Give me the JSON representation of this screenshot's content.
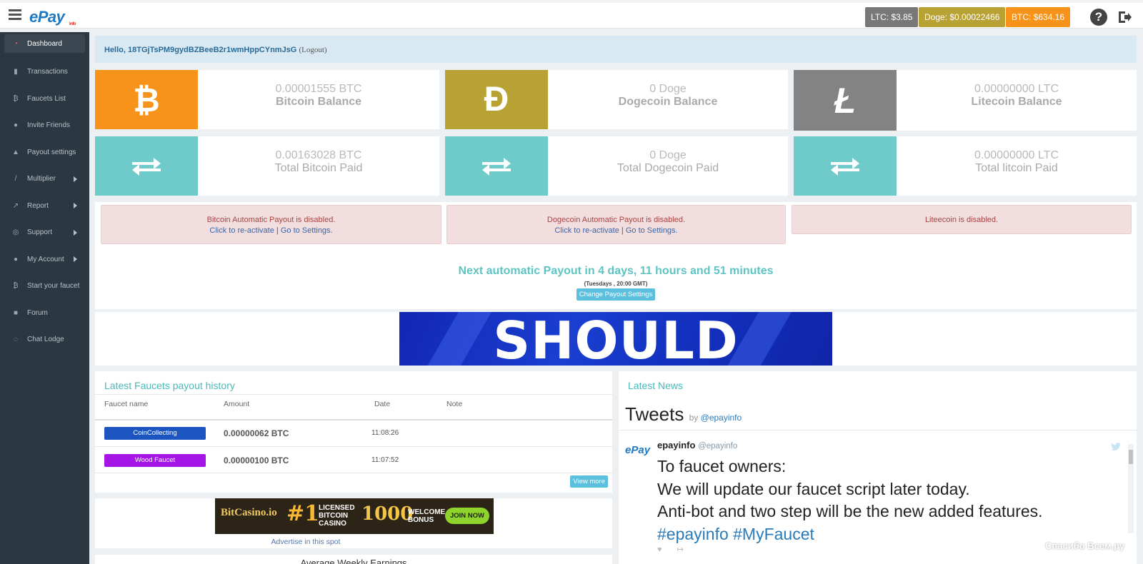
{
  "app": {
    "logo": "ePay",
    "logo_tag": "info"
  },
  "prices": [
    {
      "label": "LTC: $3.85",
      "color": "#787878"
    },
    {
      "label": "Doge: $0.00022466",
      "color": "#b8a234"
    },
    {
      "label": "BTC: $634.16",
      "color": "#f7931a"
    }
  ],
  "sidebar": {
    "items": [
      {
        "label": "Dashboard",
        "icon": "dashboard-icon"
      },
      {
        "label": "Transactions",
        "icon": "bar-chart-icon"
      },
      {
        "label": "Faucets List",
        "icon": "bitcoin-icon"
      },
      {
        "label": "Invite Friends",
        "icon": "users-icon"
      },
      {
        "label": "Payout settings",
        "icon": "bank-icon"
      },
      {
        "label": "Multiplier",
        "icon": "magic-wand-icon"
      },
      {
        "label": "Report",
        "icon": "line-chart-icon"
      },
      {
        "label": "Support",
        "icon": "lifebuoy-icon"
      },
      {
        "label": "My Account",
        "icon": "user-icon"
      },
      {
        "label": "Start your faucet",
        "icon": "bitcoin-icon"
      },
      {
        "label": "Forum",
        "icon": "comments-icon"
      },
      {
        "label": "Chat Lodge",
        "icon": "chat-icon"
      }
    ]
  },
  "hello": {
    "greeting": "Hello, 18TGjTsPM9gydBZBeeB2r1wmHppCYnmJsG",
    "logout": "(Logout)"
  },
  "balances": [
    {
      "value": "0.00001555 BTC",
      "label": "Bitcoin Balance",
      "symbol": "₿",
      "color": "#f7931a"
    },
    {
      "value": "0 Doge",
      "label": "Dogecoin Balance",
      "symbol": "Ð",
      "color": "#b8a234"
    },
    {
      "value": "0.00000000 LTC",
      "label": "Litecoin Balance",
      "symbol": "Ł",
      "color": "#838383"
    }
  ],
  "paid": [
    {
      "value": "0.00163028 BTC",
      "label": "Total Bitcoin Paid"
    },
    {
      "value": "0 Doge",
      "label": "Total Dogecoin Paid"
    },
    {
      "value": "0.00000000 LTC",
      "label": "Total litcoin Paid"
    }
  ],
  "alerts": [
    {
      "title": "Bitcoin Automatic Payout is disabled.",
      "link1": "Click to re-activate",
      "sep": "|",
      "link2": "Go to Settings."
    },
    {
      "title": "Dogecoin Automatic Payout is disabled.",
      "link1": "Click to re-activate",
      "sep": "|",
      "link2": "Go to Settings."
    },
    {
      "title": "Liteecoin is disabled."
    }
  ],
  "payout": {
    "next": "Next automatic Payout in 4 days, 11 hours and 51 minutes",
    "schedule": "(Tuesdays , 20:00 GMT)",
    "button": "Change Payout Settings"
  },
  "banner": {
    "text": "SHOULD"
  },
  "history": {
    "title": "Latest Faucets payout history",
    "columns": [
      "Faucet name",
      "Amount",
      "Date",
      "Note"
    ],
    "rows": [
      {
        "faucet": "CoinCollecting",
        "amount": "0.00000062 BTC",
        "date": "11:08:26",
        "note": "",
        "color": "#1c55c0"
      },
      {
        "faucet": "Wood Faucet",
        "amount": "0.00000100 BTC",
        "date": "11:07:52",
        "note": "",
        "color": "#a415e6"
      }
    ],
    "view_more": "View more"
  },
  "ad": {
    "brand": "BitCasino.io",
    "rank": "#1",
    "licensed": "LICENSED BITCOIN CASINO",
    "bonus": "1000",
    "welcome": "WELCOME BONUS",
    "join": "JOIN NOW",
    "advertise": "Advertise in this spot"
  },
  "bottom_panel_title": "Average Weekly Earnings",
  "news": {
    "title": "Latest News",
    "tweets_label": "Tweets",
    "tweets_by": "by",
    "tweets_handle": "@epayinfo",
    "tweet": {
      "name": "epayinfo",
      "handle": "@epayinfo",
      "lines": [
        "To faucet owners:",
        "We will update our faucet script later today.",
        "Anti-bot and two step will be the new added features."
      ],
      "hashtags": "#epayinfo #MyFaucet"
    }
  },
  "watermark": "Спасибо Всем.ру"
}
